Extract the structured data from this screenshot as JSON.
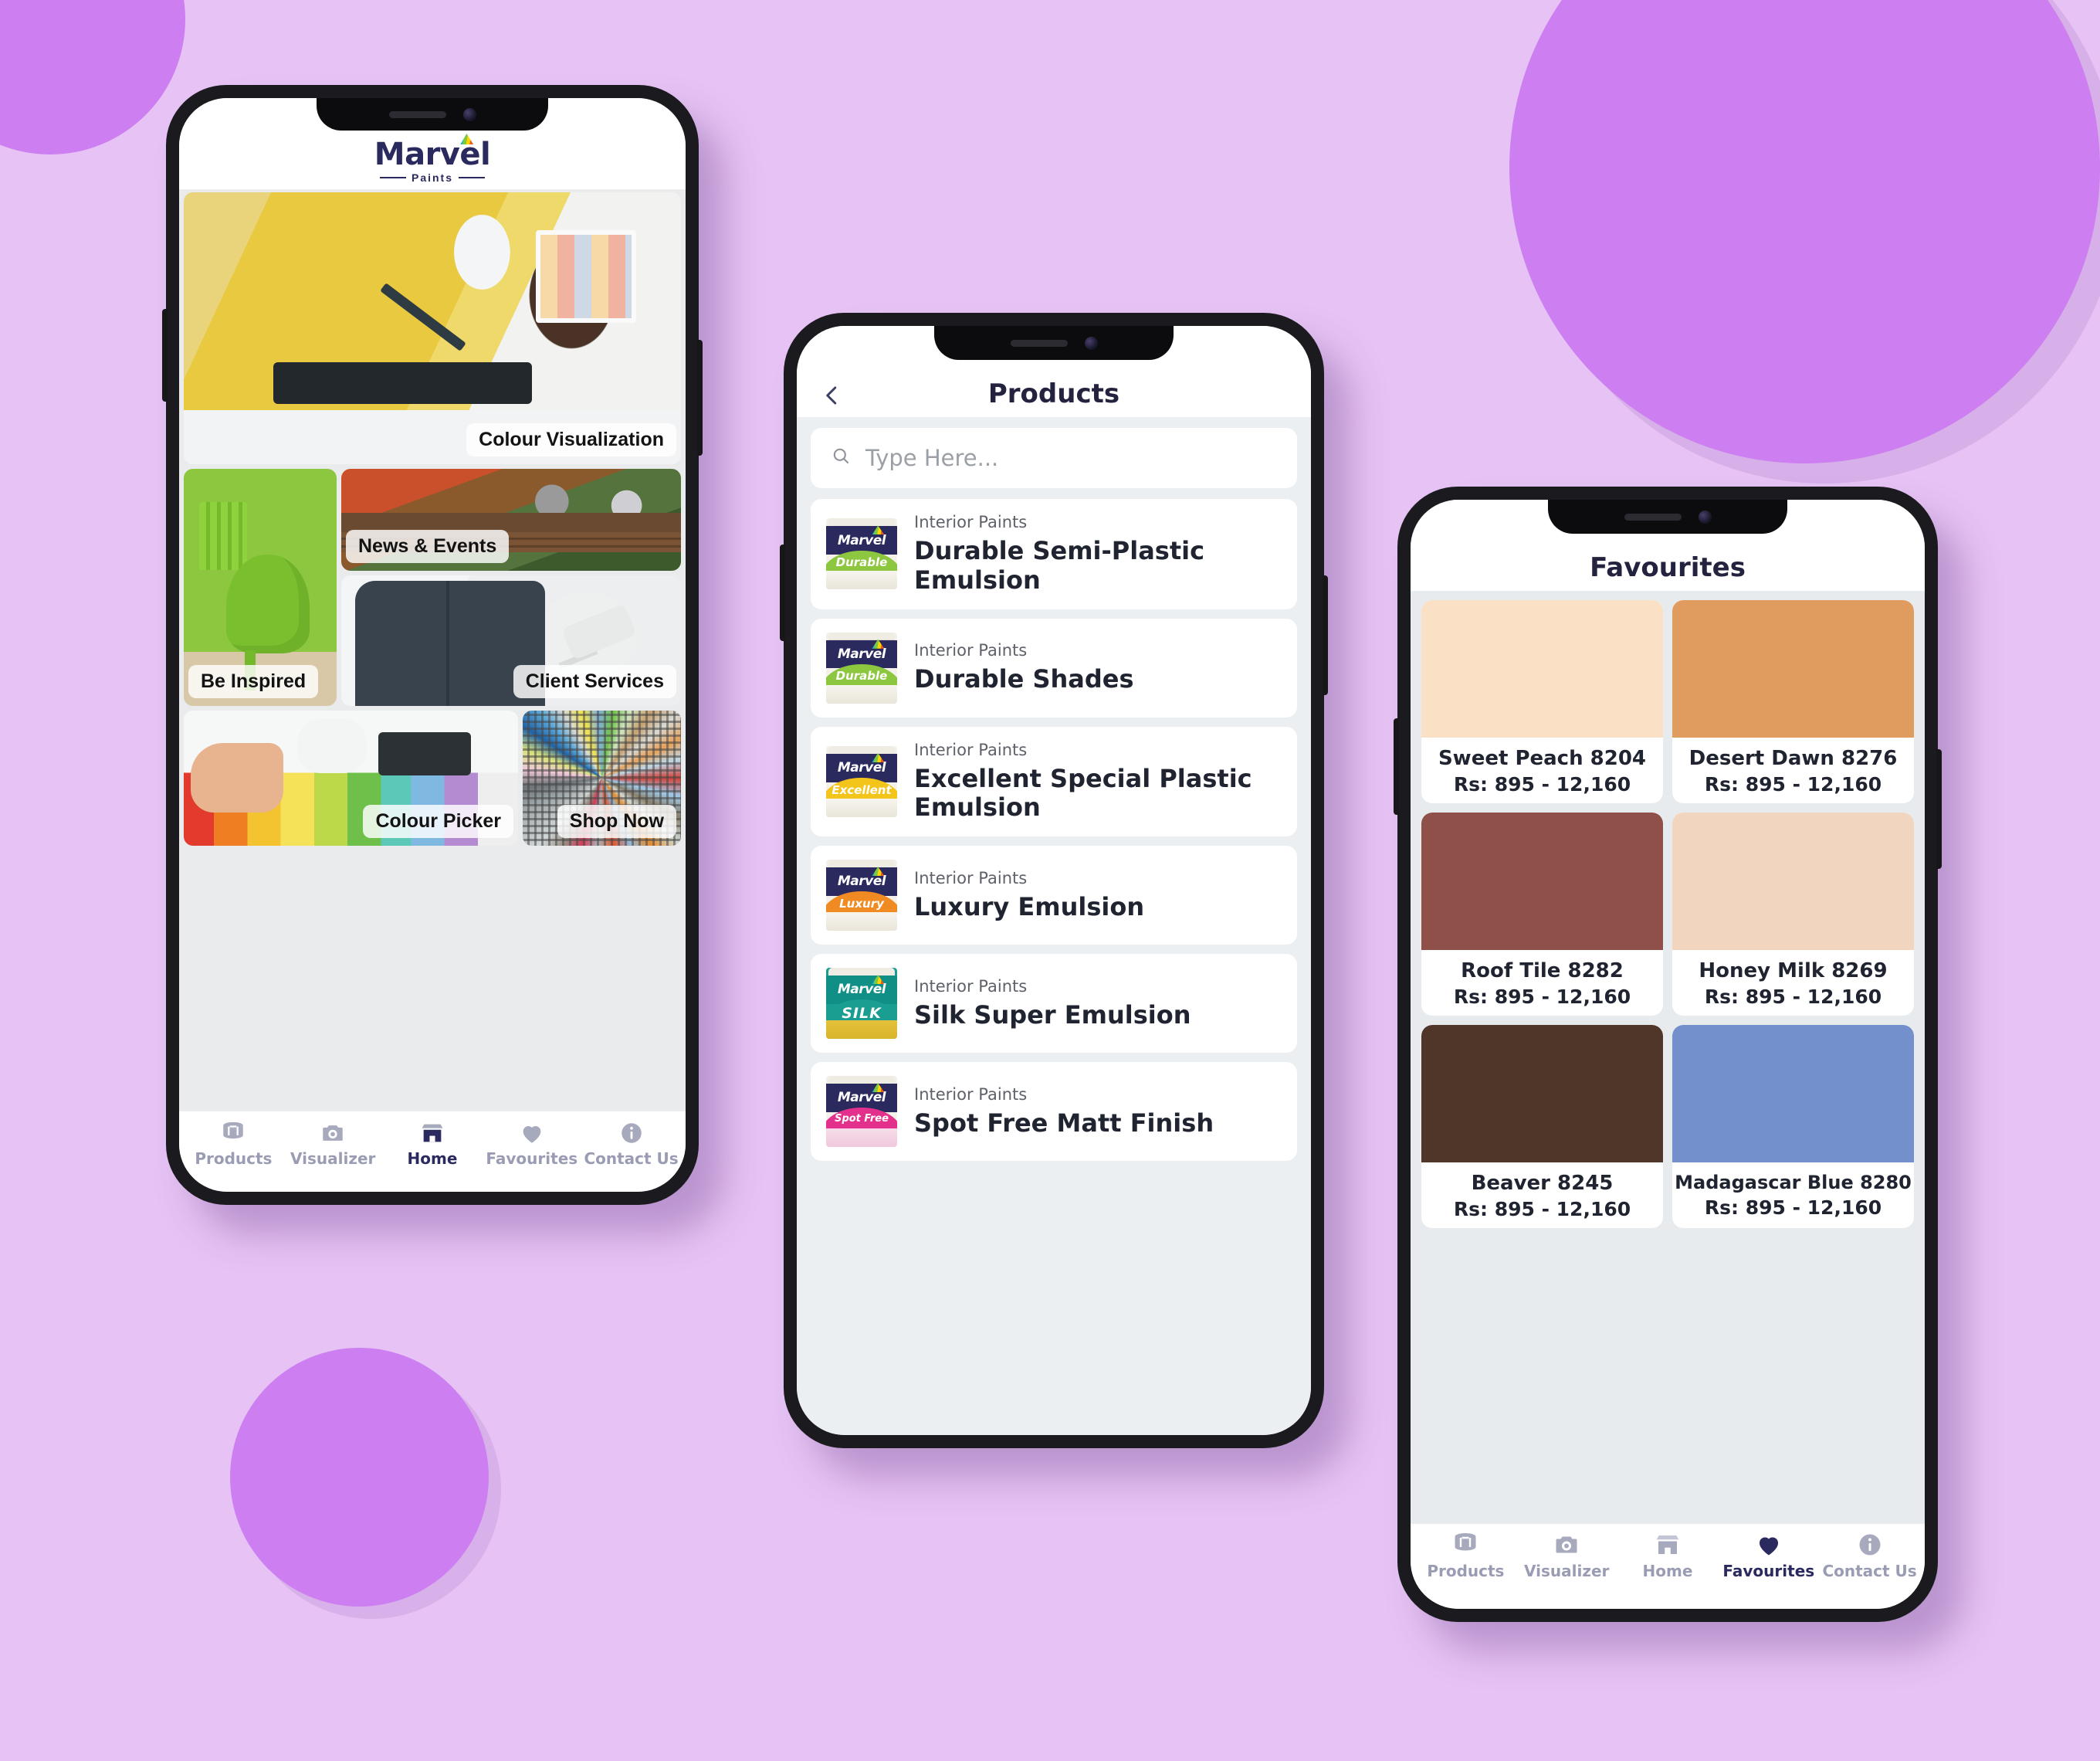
{
  "background": {
    "page_color": "#e6c3f4",
    "circle_color": "#cd7ef0"
  },
  "brand": {
    "name": "Marvel",
    "tagline": "Paints",
    "navy": "#2b2a5e"
  },
  "phone_home": {
    "screen_name": "Home",
    "tiles": [
      {
        "id": "colour-visualization",
        "label": "Colour Visualization"
      },
      {
        "id": "be-inspired",
        "label": "Be Inspired"
      },
      {
        "id": "news-events",
        "label": "News & Events"
      },
      {
        "id": "client-services",
        "label": "Client Services"
      },
      {
        "id": "colour-picker",
        "label": "Colour Picker"
      },
      {
        "id": "shop-now",
        "label": "Shop Now"
      }
    ],
    "nav": [
      {
        "icon": "products-icon",
        "label": "Products",
        "active": false
      },
      {
        "icon": "camera-icon",
        "label": "Visualizer",
        "active": false
      },
      {
        "icon": "store-icon",
        "label": "Home",
        "active": true
      },
      {
        "icon": "heart-icon",
        "label": "Favourites",
        "active": false
      },
      {
        "icon": "info-icon",
        "label": "Contact Us",
        "active": false
      }
    ]
  },
  "phone_products": {
    "title": "Products",
    "back_icon": "chevron-left-icon",
    "search": {
      "icon": "search-icon",
      "placeholder": "Type Here...",
      "value": ""
    },
    "items": [
      {
        "category": "Interior Paints",
        "name": "Durable Semi-Plastic Emulsion",
        "can_label": "Durable",
        "can_color": "#8dc63f"
      },
      {
        "category": "Interior Paints",
        "name": "Durable Shades",
        "can_label": "Durable",
        "can_color": "#8dc63f"
      },
      {
        "category": "Interior Paints",
        "name": "Excellent Special Plastic Emulsion",
        "can_label": "Excellent",
        "can_color": "#f3c41a"
      },
      {
        "category": "Interior Paints",
        "name": "Luxury Emulsion",
        "can_label": "Luxury",
        "can_color": "#ef8b22"
      },
      {
        "category": "Interior Paints",
        "name": "Silk Super Emulsion",
        "can_label": "SILK",
        "can_color": "#1a9e92"
      },
      {
        "category": "Interior Paints",
        "name": "Spot Free Matt Finish",
        "can_label": "Spot Free",
        "can_color": "#e3308c"
      }
    ]
  },
  "phone_favourites": {
    "title": "Favourites",
    "colours": [
      {
        "name": "Sweet Peach 8204",
        "price": "Rs: 895 - 12,160",
        "hex": "#fae0c4"
      },
      {
        "name": "Desert Dawn 8276",
        "price": "Rs: 895 - 12,160",
        "hex": "#e09b5e"
      },
      {
        "name": "Roof Tile 8282",
        "price": "Rs: 895 - 12,160",
        "hex": "#8e5048"
      },
      {
        "name": "Honey Milk 8269",
        "price": "Rs: 895 - 12,160",
        "hex": "#f2d5be"
      },
      {
        "name": "Beaver 8245",
        "price": "Rs: 895 - 12,160",
        "hex": "#503629"
      },
      {
        "name": "Madagascar Blue 8280",
        "price": "Rs: 895 - 12,160",
        "hex": "#7490cc"
      }
    ],
    "nav": [
      {
        "icon": "products-icon",
        "label": "Products",
        "active": false
      },
      {
        "icon": "camera-icon",
        "label": "Visualizer",
        "active": false
      },
      {
        "icon": "store-icon",
        "label": "Home",
        "active": false
      },
      {
        "icon": "heart-icon",
        "label": "Favourites",
        "active": true
      },
      {
        "icon": "info-icon",
        "label": "Contact Us",
        "active": false
      }
    ]
  }
}
